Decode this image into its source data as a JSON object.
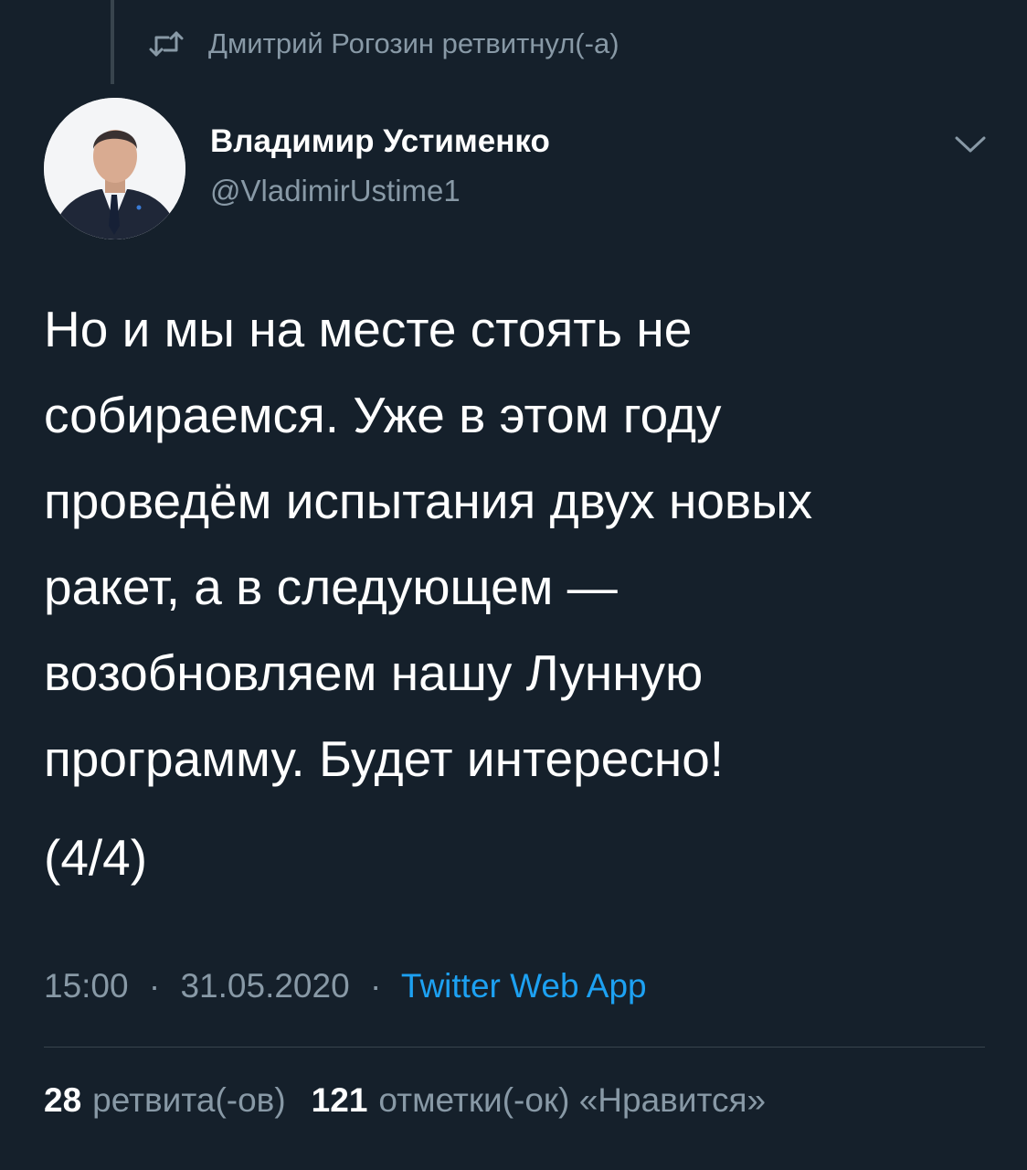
{
  "retweet": {
    "icon": "retweet-icon",
    "text": "Дмитрий Рогозин ретвитнул(-а)"
  },
  "author": {
    "name": "Владимир Устименко",
    "handle": "@VladimirUstime1",
    "avatar_icon": "avatar-photo"
  },
  "menu": {
    "icon": "chevron-down-icon"
  },
  "tweet": {
    "text": "Но и мы на месте стоять не\nсобираемся. Уже в этом году\nпроведём испытания двух новых\nракет, а в следующем —\nвозобновляем нашу Лунную\nпрограмму. Будет интересно!",
    "counter": "(4/4)"
  },
  "meta": {
    "time": "15:00",
    "separator": "·",
    "date": "31.05.2020",
    "source": "Twitter Web App"
  },
  "stats": {
    "retweets_count": "28",
    "retweets_label": "ретвита(-ов)",
    "likes_count": "121",
    "likes_label": "отметки(-ок) «Нравится»"
  },
  "colors": {
    "background": "#15202b",
    "secondary_text": "#8899a6",
    "link": "#1da1f2",
    "divider": "#38444d"
  }
}
